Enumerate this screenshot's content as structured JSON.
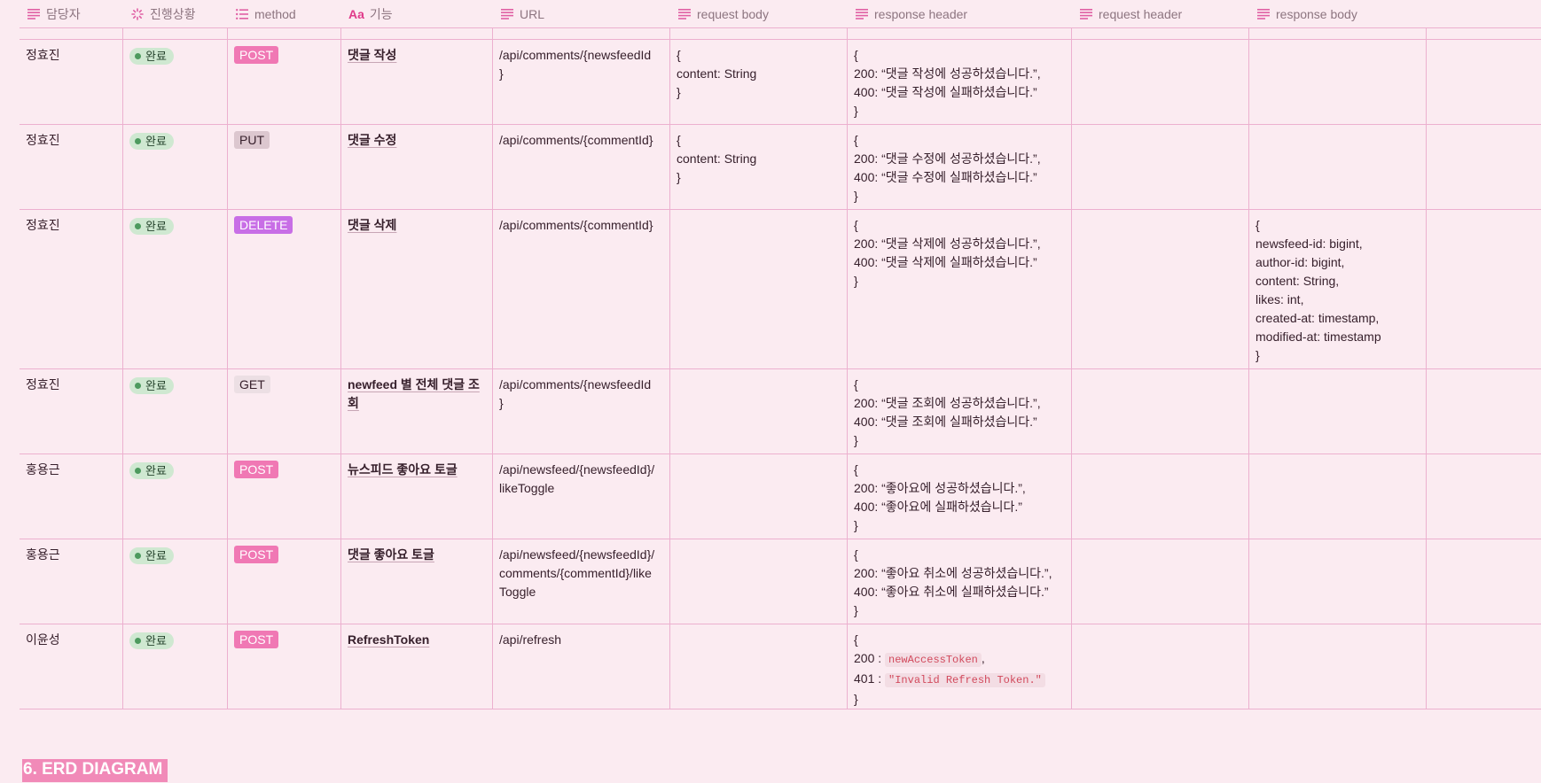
{
  "headers": [
    {
      "label": "담당자",
      "icon": "text-icon"
    },
    {
      "label": "진행상황",
      "icon": "status-icon"
    },
    {
      "label": "method",
      "icon": "list-icon"
    },
    {
      "label": "기능",
      "icon": "title-icon",
      "prefix": "Aa"
    },
    {
      "label": "URL",
      "icon": "text-icon"
    },
    {
      "label": "request body",
      "icon": "text-icon"
    },
    {
      "label": "response header",
      "icon": "text-icon"
    },
    {
      "label": "request header",
      "icon": "text-icon"
    },
    {
      "label": "response body",
      "icon": "text-icon"
    }
  ],
  "colors": {
    "POST": {
      "bg": "#f078b4",
      "fg": "#ffffff"
    },
    "PUT": {
      "bg": "#dcc7cf",
      "fg": "#37202c"
    },
    "DELETE": {
      "bg": "#c86ee6",
      "fg": "#ffffff"
    },
    "GET": {
      "bg": "#ecdfe4",
      "fg": "#37202c"
    },
    "status_bg": "#cfe8d1",
    "section_bg": "#f18ab8"
  },
  "rows": [
    {
      "assignee": "정효진",
      "status": "완료",
      "method": "POST",
      "function": "댓글 작성",
      "url": "/api/comments/{newsfeedId\n}",
      "request_body": "{\ncontent: String\n}",
      "response_header": "{\n200: “댓글 작성에 성공하셨습니다.”,\n400: “댓글 작성에 실패하셨습니다.”\n}",
      "request_header": "",
      "response_body": ""
    },
    {
      "assignee": "정효진",
      "status": "완료",
      "method": "PUT",
      "function": "댓글 수정",
      "url": "/api/comments/{commentId}",
      "request_body": "{\ncontent: String\n}",
      "response_header": "{\n200: “댓글 수정에 성공하셨습니다.”,\n400: “댓글 수정에 실패하셨습니다.”\n}",
      "request_header": "",
      "response_body": ""
    },
    {
      "assignee": "정효진",
      "status": "완료",
      "method": "DELETE",
      "function": "댓글 삭제",
      "url": "/api/comments/{commentId}",
      "request_body": "",
      "response_header": "{\n200: “댓글 삭제에 성공하셨습니다.”,\n400: “댓글 삭제에 실패하셨습니다.”\n}",
      "request_header": "",
      "response_body": "{\nnewsfeed-id: bigint,\nauthor-id: bigint,\ncontent: String,\nlikes: int,\ncreated-at: timestamp,\nmodified-at: timestamp\n}"
    },
    {
      "assignee": "정효진",
      "status": "완료",
      "method": "GET",
      "function": "newfeed 별 전체 댓글 조회",
      "url": "/api/comments/{newsfeedId\n}",
      "request_body": "",
      "response_header": "{\n200: “댓글 조회에 성공하셨습니다.”,\n400: “댓글 조회에 실패하셨습니다.”\n}",
      "request_header": "",
      "response_body": ""
    },
    {
      "assignee": "홍용근",
      "status": "완료",
      "method": "POST",
      "function": "뉴스피드 좋아요 토글",
      "url": "/api/newsfeed/{newsfeedId}/\nlikeToggle",
      "request_body": "",
      "response_header": "{\n200: “좋아요에 성공하셨습니다.”,\n400: “좋아요에 실패하셨습니다.”\n}",
      "request_header": "",
      "response_body": ""
    },
    {
      "assignee": "홍용근",
      "status": "완료",
      "method": "POST",
      "function": "댓글 좋아요 토글",
      "url": "/api/newsfeed/{newsfeedId}/\ncomments/{commentId}/like\nToggle",
      "request_body": "",
      "response_header": "{\n200: “좋아요 취소에 성공하셨습니다.”,\n400: “좋아요 취소에 실패하셨습니다.”\n}",
      "request_header": "",
      "response_body": ""
    },
    {
      "assignee": "이윤성",
      "status": "완료",
      "method": "POST",
      "function": "RefreshToken",
      "url": "/api/refresh",
      "request_body": "",
      "response_header_parts": {
        "open": "{",
        "line1_prefix": "200 : ",
        "line1_code": "newAccessToken",
        "line1_suffix": ",",
        "line2_prefix": "401 : ",
        "line2_code": "\"Invalid Refresh Token.\"",
        "close": "}"
      },
      "request_header": "",
      "response_body": ""
    }
  ],
  "section_title": "6. ERD DIAGRAM"
}
